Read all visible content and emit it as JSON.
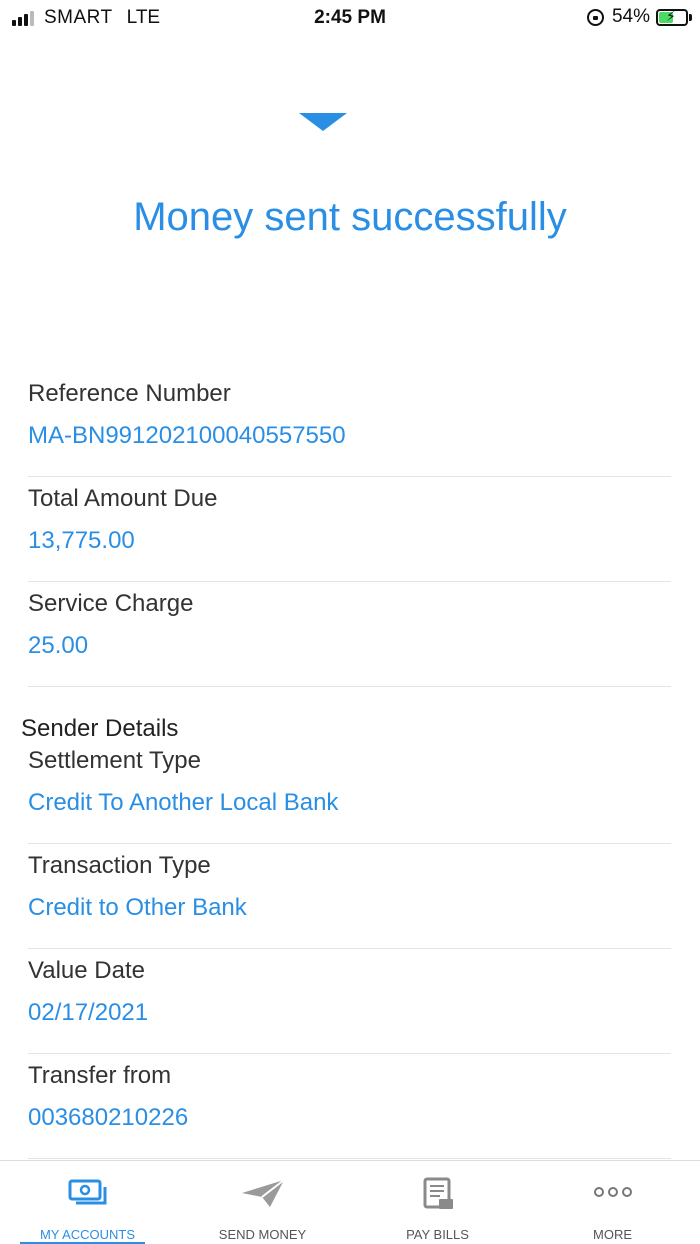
{
  "status_bar": {
    "carrier": "SMART",
    "network": "LTE",
    "time": "2:45 PM",
    "battery": "54%",
    "battery_level": 0.54
  },
  "header": {
    "headline": "Money sent successfully"
  },
  "fields": [
    {
      "label": "Reference Number",
      "value": "MA-BN991202100040557550"
    },
    {
      "label": "Total Amount Due",
      "value": "13,775.00"
    },
    {
      "label": "Service Charge",
      "value": "25.00"
    }
  ],
  "sender_section_title": "Sender Details",
  "sender_fields": [
    {
      "label": "Settlement Type",
      "value": "Credit To Another Local Bank"
    },
    {
      "label": "Transaction Type",
      "value": "Credit to Other Bank"
    },
    {
      "label": "Value Date",
      "value": "02/17/2021"
    },
    {
      "label": "Transfer from",
      "value": "003680210226"
    }
  ],
  "tabs": [
    {
      "label": "MY ACCOUNTS",
      "icon": "accounts-icon",
      "active": true
    },
    {
      "label": "SEND MONEY",
      "icon": "send-icon",
      "active": false
    },
    {
      "label": "PAY BILLS",
      "icon": "bill-icon",
      "active": false
    },
    {
      "label": "MORE",
      "icon": "more-icon",
      "active": false
    }
  ],
  "colors": {
    "accent": "#2a8fe4",
    "text": "#333333",
    "divider": "#e4e4e4"
  }
}
